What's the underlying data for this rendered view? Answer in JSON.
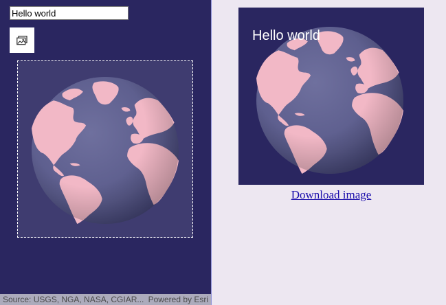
{
  "map_view": {
    "text_input": {
      "value": "Hello world"
    },
    "screenshot_button_icon": "image-icon",
    "attribution": {
      "source": "Source: USGS, NGA, NASA, CGIAR...",
      "powered_by": "Powered by Esri"
    }
  },
  "preview": {
    "overlay_text": "Hello world",
    "download_label": "Download image"
  },
  "colors": {
    "background_space": "#2a2660",
    "ocean": "#5e5f8f",
    "land": "#f2b8c6",
    "page_background": "#ede7f1",
    "link": "#1a0dab"
  }
}
